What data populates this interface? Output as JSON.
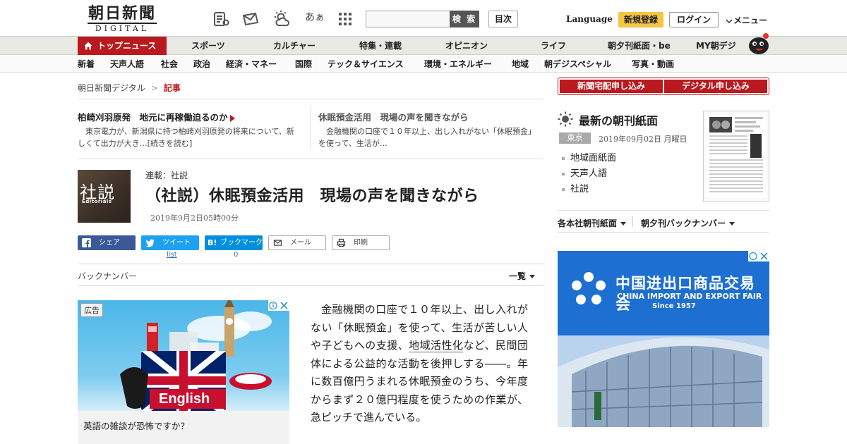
{
  "header": {
    "logo_jp": "朝日新聞",
    "logo_en": "DIGITAL",
    "search_button": "検 索",
    "toc_button": "目次",
    "language": "Language",
    "register": "新規登録",
    "login": "ログイン",
    "menu": "メニュー",
    "font_size_glyph": "あぁ"
  },
  "nav_main": {
    "top": "トップニュース",
    "items": [
      "スポーツ",
      "カルチャー",
      "特集・連載",
      "オピニオン",
      "ライフ",
      "朝夕刊紙面・be",
      "MY朝デジ"
    ]
  },
  "nav_sub": {
    "items": [
      "新着",
      "天声人語",
      "社会",
      "政治",
      "経済・マネー",
      "国際",
      "テック＆サイエンス",
      "環境・エネルギー",
      "地域",
      "朝デジスペシャル",
      "写真・動画"
    ]
  },
  "breadcrumb": {
    "home": "朝日新聞デジタル",
    "sep": ">",
    "current": "記事"
  },
  "related": [
    {
      "title": "柏崎刈羽原発　地元に再稼働迫るのか",
      "text": "東京電力が、新潟県に持つ柏崎刈羽原発の将来について、新しくて出力が大き…[続きを読む]"
    },
    {
      "title": "休眠預金活用　現場の声を聞きながら",
      "text": "金融機関の口座で１０年以上、出し入れがない「休眠預金」を使って、生活が…"
    }
  ],
  "article": {
    "thumb_kanji": "社説",
    "thumb_en": "Editorials",
    "series": "連載：社説",
    "title": "（社説）休眠預金活用　現場の声を聞きながら",
    "date": "2019年9月2日05時00分",
    "body_before": "金融機関の口座で１０年以上、出し入れがない「休眠預金」を使って、生活が苦しい人や子どもへの支援、",
    "body_link": "地域活性化",
    "body_after": "など、民間団体による公益的な活動を後押しする――。年に数百億円うまれる休眠預金のうち、今年度からまず２０億円程度を使うための作業が、急ピッチで進んでいる。"
  },
  "share": {
    "facebook": "シェア",
    "twitter": "ツイート",
    "hatena": "ブックマーク",
    "mail": "メール",
    "print": "印刷",
    "twitter_count": "list",
    "hatena_count": "0",
    "hatena_logo": "B!"
  },
  "backnumber": {
    "label": "バックナンバー",
    "list": "一覧"
  },
  "ad_left": {
    "badge": "広告",
    "caption": "英語の雑談が恐怖ですか？",
    "english": "English"
  },
  "right": {
    "subscribe_home": "新聞宅配申し込み",
    "subscribe_digital": "デジタル申し込み",
    "morning_title": "最新の朝刊紙面",
    "region": "東京",
    "morning_date": "2019年09月02日 月曜日",
    "links": [
      "地域面紙面",
      "天声人語",
      "社説"
    ],
    "back1": "各本社朝刊紙面",
    "back2": "朝夕刊バックナンバー"
  },
  "ad_right": {
    "title_cn": "中国进出口商品交易会",
    "title_en": "CHINA IMPORT AND EXPORT FAIR",
    "since": "Since 1957"
  },
  "colors": {
    "accent": "#b9191f",
    "facebook": "#3b5998",
    "twitter": "#1da1f2",
    "hatena": "#008fde",
    "register": "#f3c644"
  }
}
